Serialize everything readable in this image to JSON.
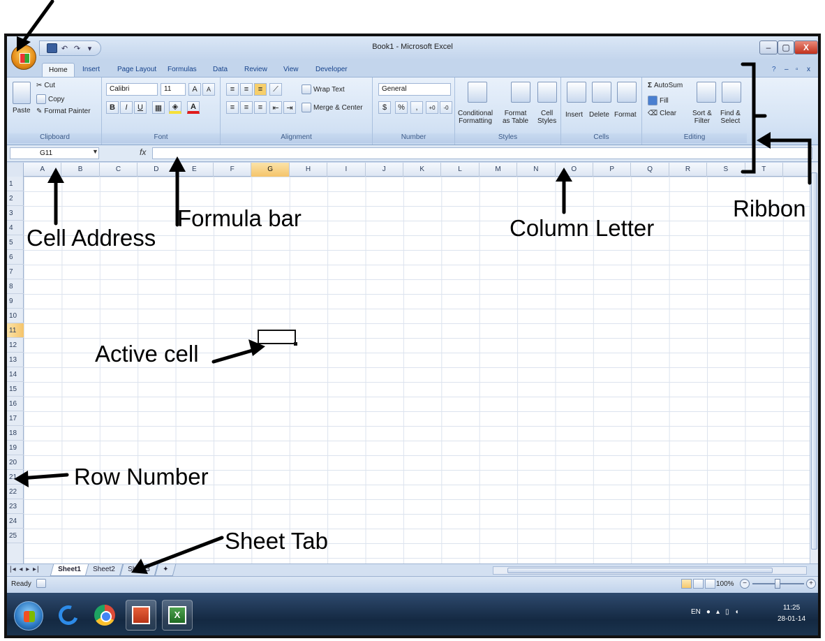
{
  "window": {
    "title": "Book1 - Microsoft Excel"
  },
  "tabs": [
    "Home",
    "Insert",
    "Page Layout",
    "Formulas",
    "Data",
    "Review",
    "View",
    "Developer"
  ],
  "clipboard": {
    "paste": "Paste",
    "cut": "Cut",
    "copy": "Copy",
    "format_painter": "Format Painter",
    "label": "Clipboard"
  },
  "font": {
    "family": "Calibri",
    "size": "11",
    "bold": "B",
    "italic": "I",
    "underline": "U",
    "label": "Font"
  },
  "alignment": {
    "wrap": "Wrap Text",
    "merge": "Merge & Center",
    "label": "Alignment"
  },
  "number": {
    "format": "General",
    "percent": "%",
    "comma": ",",
    "label": "Number"
  },
  "styles": {
    "conditional": "Conditional",
    "conditional2": "Formatting",
    "format_table": "Format",
    "format_table2": "as Table",
    "cell_styles": "Cell",
    "cell_styles2": "Styles",
    "label": "Styles"
  },
  "cells": {
    "insert": "Insert",
    "delete": "Delete",
    "format": "Format",
    "label": "Cells"
  },
  "editing": {
    "autosum": "AutoSum",
    "fill": "Fill",
    "clear": "Clear",
    "sort": "Sort &",
    "sort2": "Filter",
    "find": "Find &",
    "find2": "Select",
    "label": "Editing"
  },
  "formula_bar": {
    "name_box": "G11",
    "fx": "fx"
  },
  "columns": [
    "A",
    "B",
    "C",
    "D",
    "E",
    "F",
    "G",
    "H",
    "I",
    "J",
    "K",
    "L",
    "M",
    "N",
    "O",
    "P",
    "Q",
    "R",
    "S",
    "T"
  ],
  "rows": [
    "1",
    "2",
    "3",
    "4",
    "5",
    "6",
    "7",
    "8",
    "9",
    "10",
    "11",
    "12",
    "13",
    "14",
    "15",
    "16",
    "17",
    "18",
    "19",
    "20",
    "21",
    "22",
    "23",
    "24",
    "25"
  ],
  "sheets": [
    "Sheet1",
    "Sheet2",
    "Sheet3"
  ],
  "status": {
    "text": "Ready",
    "zoom": "100%",
    "zoom_minus": "−",
    "zoom_plus": "+"
  },
  "taskbar": {
    "tray_lang": "EN",
    "time": "11:25",
    "date": "28-01-14"
  },
  "annotations": {
    "cell_address": "Cell Address",
    "formula_bar": "Formula bar",
    "column_letter": "Column Letter",
    "ribbon": "Ribbon",
    "active_cell": "Active cell",
    "row_number": "Row Number",
    "sheet_tab": "Sheet Tab"
  }
}
